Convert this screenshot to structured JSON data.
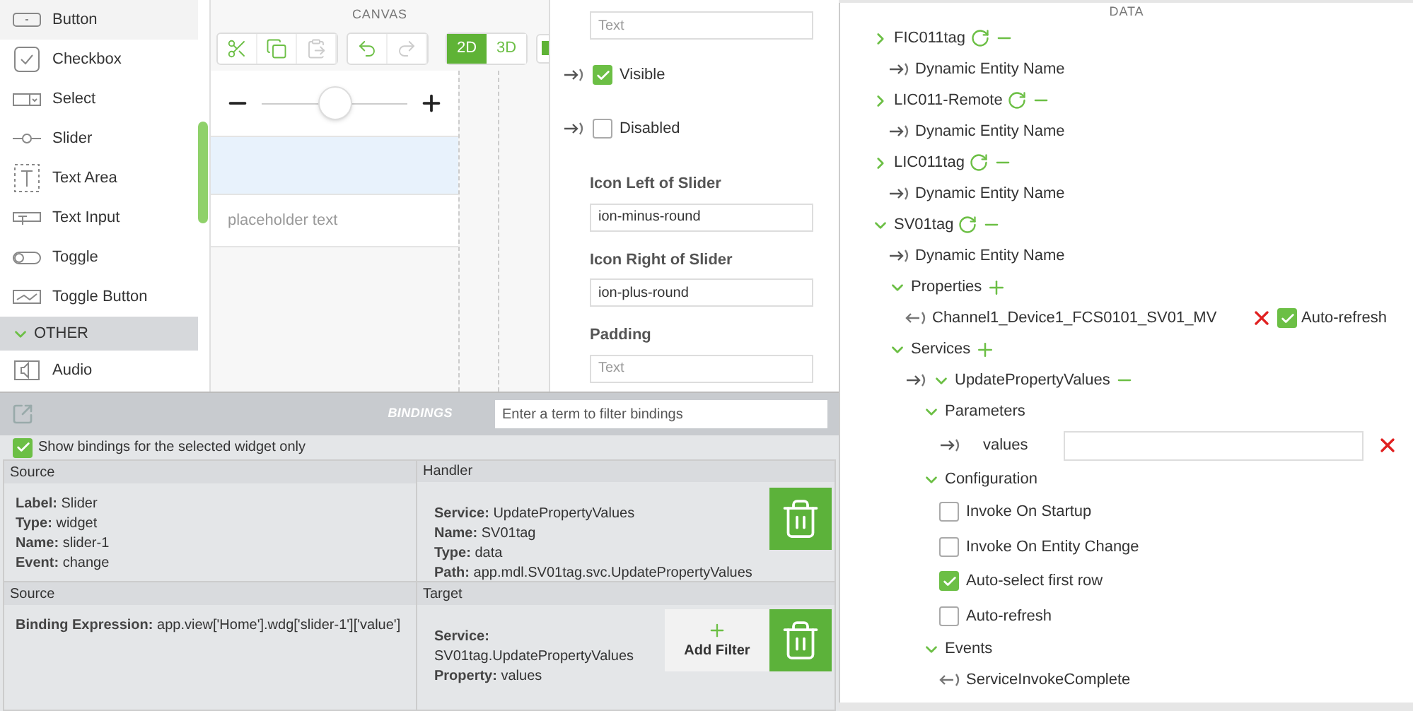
{
  "palette": {
    "items": [
      {
        "kind": "button",
        "label": "Button"
      },
      {
        "kind": "checkbox",
        "label": "Checkbox"
      },
      {
        "kind": "select",
        "label": "Select"
      },
      {
        "kind": "slider",
        "label": "Slider"
      },
      {
        "kind": "textarea",
        "label": "Text Area"
      },
      {
        "kind": "textinput",
        "label": "Text Input"
      },
      {
        "kind": "toggle",
        "label": "Toggle"
      },
      {
        "kind": "togglebutton",
        "label": "Toggle Button"
      },
      {
        "kind": "group",
        "label": "OTHER",
        "expanded": true
      },
      {
        "kind": "audio",
        "label": "Audio"
      }
    ]
  },
  "canvas": {
    "title": "CANVAS",
    "tools": [
      {
        "kind": "cut",
        "disabled": false
      },
      {
        "kind": "copy",
        "disabled": false
      },
      {
        "kind": "paste",
        "disabled": true
      },
      {
        "kind": "undo",
        "disabled": false
      },
      {
        "kind": "redo",
        "disabled": true
      }
    ],
    "modes": [
      {
        "label": "2D",
        "selected": true
      },
      {
        "label": "3D",
        "selected": false
      }
    ],
    "widgets": [
      {
        "kind": "slider",
        "level": 0.5,
        "selected": false
      },
      {
        "kind": "blank",
        "selected": true
      },
      {
        "kind": "input",
        "placeholder": "placeholder text",
        "selected": false
      }
    ]
  },
  "properties": {
    "items": [
      {
        "kind": "field",
        "placeholder": "Text"
      },
      {
        "kind": "checkbox",
        "label": "Visible",
        "checked": true
      },
      {
        "kind": "checkbox",
        "label": "Disabled",
        "checked": false
      },
      {
        "kind": "field",
        "label": "Icon Left of Slider",
        "value": "ion-minus-round"
      },
      {
        "kind": "field",
        "label": "Icon Right of Slider",
        "value": "ion-plus-round"
      },
      {
        "kind": "field",
        "label": "Padding",
        "placeholder": "Text"
      }
    ]
  },
  "bindings": {
    "title": "BINDINGS",
    "filter_placeholder": "Enter a term to filter bindings",
    "show_selected_only": {
      "label": "Show bindings for the selected widget only",
      "checked": true
    },
    "rows": [
      {
        "source": {
          "title": "Source",
          "lines": [
            {
              "key": "Label:",
              "value": "Slider"
            },
            {
              "key": "Type:",
              "value": "widget"
            },
            {
              "key": "Name:",
              "value": "slider-1"
            },
            {
              "key": "Event:",
              "value": "change"
            }
          ]
        },
        "target": {
          "title": "Handler",
          "lines": [
            {
              "key": "Service:",
              "value": "UpdatePropertyValues"
            },
            {
              "key": "Name:",
              "value": "SV01tag"
            },
            {
              "key": "Type:",
              "value": "data"
            },
            {
              "key": "Path:",
              "value": "app.mdl.SV01tag.svc.UpdatePropertyValues"
            }
          ]
        }
      },
      {
        "source": {
          "title": "Source",
          "lines": [
            {
              "key": "Binding Expression:",
              "value": "app.view['Home'].wdg['slider-1']['value']"
            }
          ]
        },
        "target": {
          "title": "Target",
          "add_filter": "Add Filter",
          "lines": [
            {
              "key": "Service:",
              "value": "SV01tag.UpdatePropertyValues"
            },
            {
              "key": "Property:",
              "value": "values"
            }
          ]
        }
      }
    ]
  },
  "data": {
    "title": "DATA",
    "tree": [
      {
        "kind": "entity",
        "label": "FIC011tag",
        "expanded": false,
        "children": [
          {
            "kind": "input",
            "label": "Dynamic Entity Name"
          }
        ]
      },
      {
        "kind": "entity",
        "label": "LIC011-Remote",
        "expanded": false,
        "children": [
          {
            "kind": "input",
            "label": "Dynamic Entity Name"
          }
        ]
      },
      {
        "kind": "entity",
        "label": "LIC011tag",
        "expanded": false,
        "children": [
          {
            "kind": "input",
            "label": "Dynamic Entity Name"
          }
        ]
      },
      {
        "kind": "entity",
        "label": "SV01tag",
        "expanded": true,
        "children": [
          {
            "kind": "input",
            "label": "Dynamic Entity Name"
          },
          {
            "kind": "section",
            "label": "Properties",
            "addable": true,
            "expanded": true,
            "children": [
              {
                "kind": "property",
                "label": "Channel1_Device1_FCS0101_SV01_MV",
                "option": "Auto-refresh",
                "checked": true
              }
            ]
          },
          {
            "kind": "section",
            "label": "Services",
            "addable": true,
            "expanded": true,
            "children": [
              {
                "kind": "service",
                "label": "UpdatePropertyValues",
                "expanded": true,
                "children": [
                  {
                    "kind": "section",
                    "label": "Parameters",
                    "expanded": true,
                    "children": [
                      {
                        "kind": "param",
                        "label": "values"
                      }
                    ]
                  },
                  {
                    "kind": "section",
                    "label": "Configuration",
                    "expanded": true,
                    "children": [
                      {
                        "kind": "option",
                        "label": "Invoke On Startup",
                        "checked": false
                      },
                      {
                        "kind": "option",
                        "label": "Invoke On Entity Change",
                        "checked": false
                      },
                      {
                        "kind": "option",
                        "label": "Auto-select first row",
                        "checked": true
                      },
                      {
                        "kind": "option",
                        "label": "Auto-refresh",
                        "checked": false
                      }
                    ]
                  },
                  {
                    "kind": "section",
                    "label": "Events",
                    "expanded": true,
                    "children": [
                      {
                        "kind": "event",
                        "label": "ServiceInvokeComplete"
                      }
                    ]
                  }
                ]
              }
            ]
          }
        ]
      }
    ]
  }
}
